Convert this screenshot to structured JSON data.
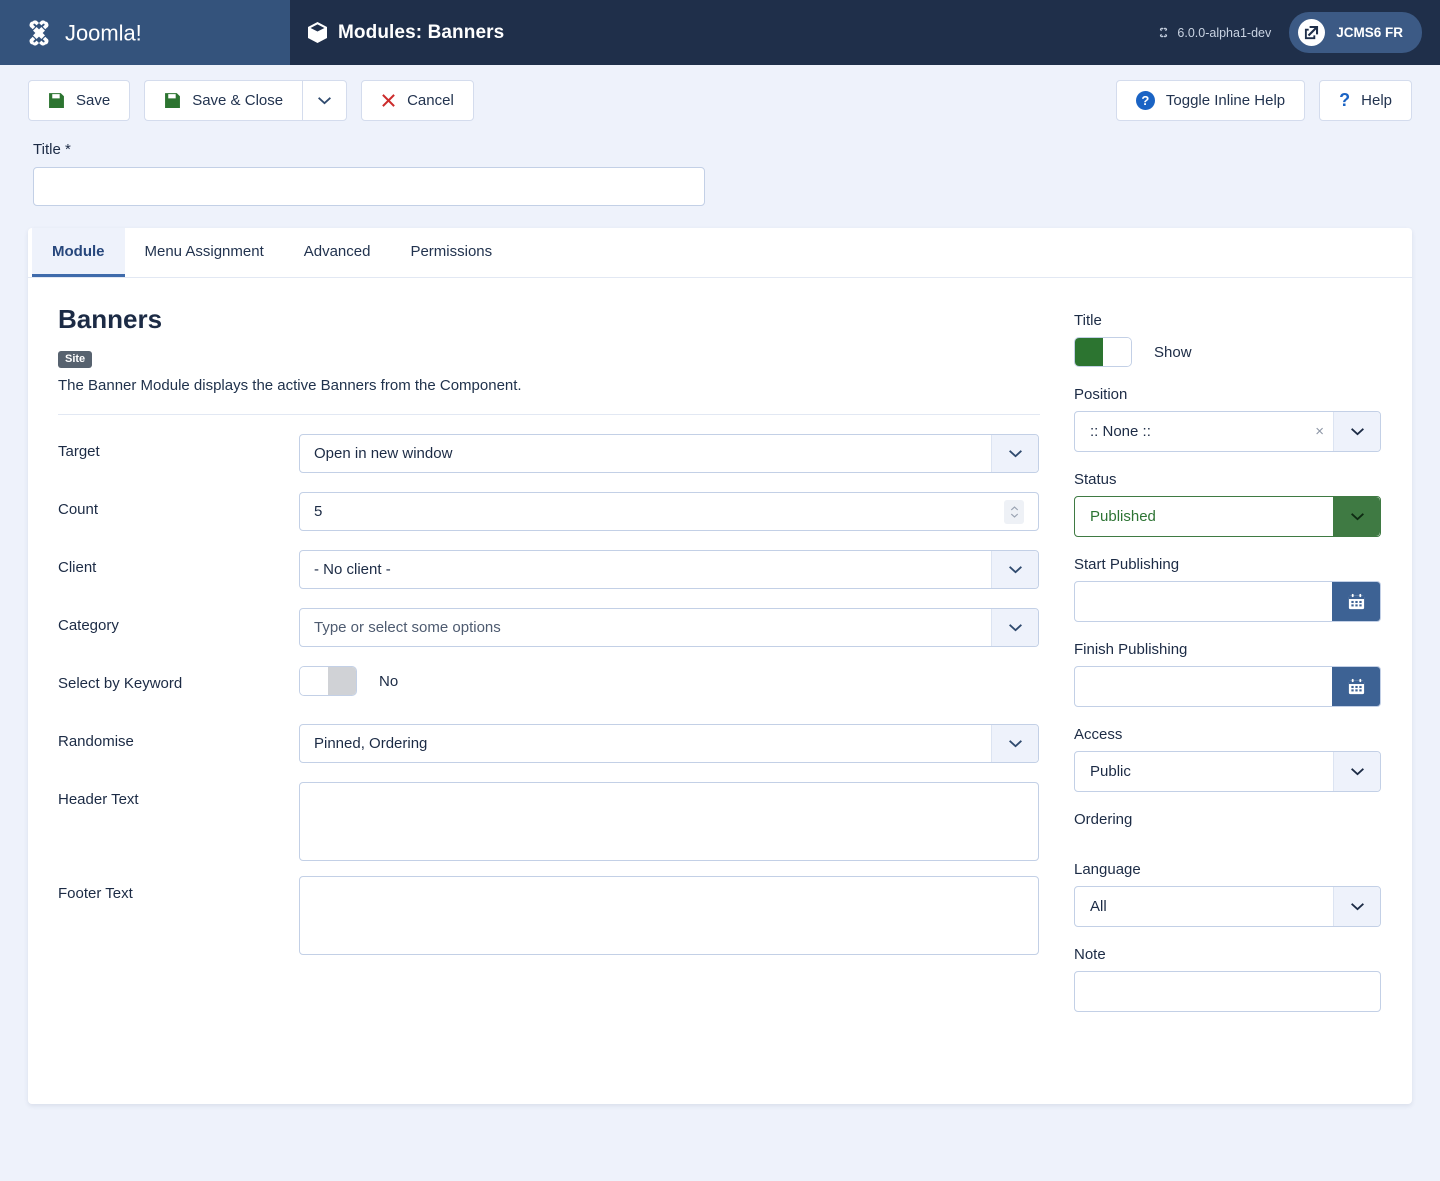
{
  "topbar": {
    "brand_name": "Joomla!",
    "page_title": "Modules: Banners",
    "version": "6.0.0-alpha1-dev",
    "user_badge": "JCMS6 FR"
  },
  "toolbar": {
    "save_label": "Save",
    "save_close_label": "Save & Close",
    "save_dropdown_label": "",
    "cancel_label": "Cancel",
    "toggle_inline_help_label": "Toggle Inline Help",
    "help_label": "Help",
    "qmark": "?"
  },
  "title_field": {
    "label": "Title *",
    "value": "",
    "placeholder": ""
  },
  "tabs": [
    {
      "label": "Module",
      "active": true
    },
    {
      "label": "Menu Assignment",
      "active": false
    },
    {
      "label": "Advanced",
      "active": false
    },
    {
      "label": "Permissions",
      "active": false
    }
  ],
  "module": {
    "name": "Banners",
    "badge": "Site",
    "description": "The Banner Module displays the active Banners from the Component."
  },
  "fields": {
    "target": {
      "label": "Target",
      "value": "Open in new window"
    },
    "count": {
      "label": "Count",
      "value": "5"
    },
    "client": {
      "label": "Client",
      "value": "- No client -"
    },
    "category": {
      "label": "Category",
      "placeholder": "Type or select some options",
      "value": "Type or select some options"
    },
    "select_by_keyword": {
      "label": "Select by Keyword",
      "state": "No"
    },
    "randomise": {
      "label": "Randomise",
      "value": "Pinned, Ordering"
    },
    "header_text": {
      "label": "Header Text",
      "value": ""
    },
    "footer_text": {
      "label": "Footer Text",
      "value": ""
    }
  },
  "sidebar": {
    "title": {
      "label": "Title",
      "state": "Show"
    },
    "position": {
      "label": "Position",
      "value": ":: None ::",
      "clear": "×"
    },
    "status": {
      "label": "Status",
      "value": "Published"
    },
    "start_publishing": {
      "label": "Start Publishing",
      "value": ""
    },
    "finish_publishing": {
      "label": "Finish Publishing",
      "value": ""
    },
    "access": {
      "label": "Access",
      "value": "Public"
    },
    "ordering": {
      "label": "Ordering"
    },
    "language": {
      "label": "Language",
      "value": "All"
    },
    "note": {
      "label": "Note",
      "value": ""
    }
  },
  "colors": {
    "brand_dark": "#1f2f4a",
    "brand_mid": "#34537c",
    "accent_blue": "#3f6bab",
    "green": "#2c7430",
    "red": "#cc2b2b",
    "page_bg": "#eef2fb"
  }
}
